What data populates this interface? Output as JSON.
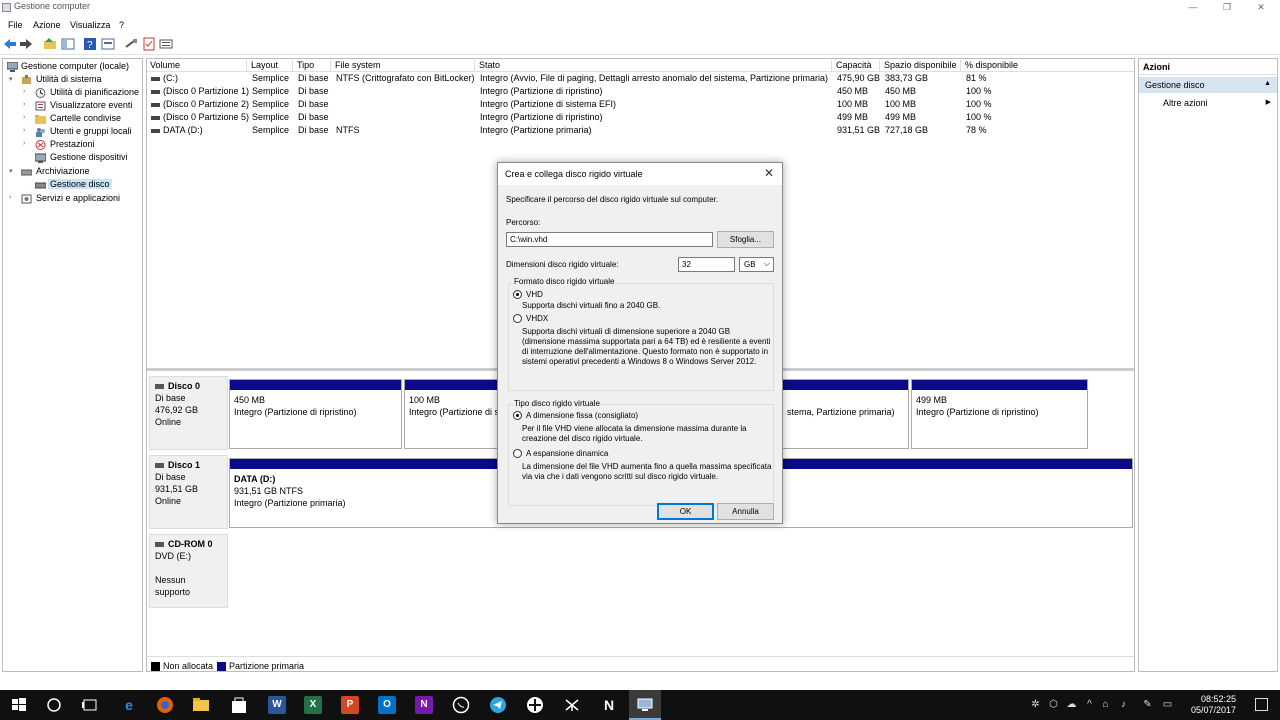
{
  "window": {
    "title": "Gestione computer",
    "controls": [
      "—",
      "❐",
      "✕"
    ]
  },
  "menu": [
    "File",
    "Azione",
    "Visualizza",
    "?"
  ],
  "tree": {
    "root": "Gestione computer (locale)",
    "system_tools": "Utilità di sistema",
    "task_scheduler": "Utilità di pianificazione",
    "event_viewer": "Visualizzatore eventi",
    "shared_folders": "Cartelle condivise",
    "users_groups": "Utenti e gruppi locali",
    "performance": "Prestazioni",
    "device_manager": "Gestione dispositivi",
    "storage": "Archiviazione",
    "disk_management": "Gestione disco",
    "services": "Servizi e applicazioni"
  },
  "volumes": {
    "headers": [
      "Volume",
      "Layout",
      "Tipo",
      "File system",
      "Stato",
      "Capacità",
      "Spazio disponibile",
      "% disponibile"
    ],
    "rows": [
      [
        "(C:)",
        "Semplice",
        "Di base",
        "NTFS (Crittografato con BitLocker)",
        "Integro (Avvio, File di paging, Dettagli arresto anomalo del sistema, Partizione primaria)",
        "475,90 GB",
        "383,73 GB",
        "81 %"
      ],
      [
        "(Disco 0 Partizione 1)",
        "Semplice",
        "Di base",
        "",
        "Integro (Partizione di ripristino)",
        "450 MB",
        "450 MB",
        "100 %"
      ],
      [
        "(Disco 0 Partizione 2)",
        "Semplice",
        "Di base",
        "",
        "Integro (Partizione di sistema EFI)",
        "100 MB",
        "100 MB",
        "100 %"
      ],
      [
        "(Disco 0 Partizione 5)",
        "Semplice",
        "Di base",
        "",
        "Integro (Partizione di ripristino)",
        "499 MB",
        "499 MB",
        "100 %"
      ],
      [
        "DATA (D:)",
        "Semplice",
        "Di base",
        "NTFS",
        "Integro (Partizione primaria)",
        "931,51 GB",
        "727,18 GB",
        "78 %"
      ]
    ]
  },
  "disks": [
    {
      "name": "Disco 0",
      "type": "Di base",
      "size": "476,92 GB",
      "status": "Online"
    },
    {
      "name": "Disco 1",
      "type": "Di base",
      "size": "931,51 GB",
      "status": "Online"
    },
    {
      "name": "CD-ROM 0",
      "type": "DVD (E:)",
      "size": "",
      "status": "Nessun supporto"
    }
  ],
  "partitions": {
    "d0p1": {
      "size": "450 MB",
      "status": "Integro (Partizione di ripristino)"
    },
    "d0p2": {
      "size": "100 MB",
      "status": "Integro (Partizione di s"
    },
    "d0p3": {
      "status": "stema, Partizione primaria)"
    },
    "d0p5": {
      "size": "499 MB",
      "status": "Integro (Partizione di ripristino)"
    },
    "d1p1": {
      "name": "DATA  (D:)",
      "size": "931,51 GB NTFS",
      "status": "Integro (Partizione primaria)"
    }
  },
  "legend": {
    "unallocated": "Non allocata",
    "primary": "Partizione primaria"
  },
  "actions": {
    "header": "Azioni",
    "section": "Gestione disco",
    "more": "Altre azioni"
  },
  "dialog": {
    "title": "Crea e collega disco rigido virtuale",
    "intro": "Specificare il percorso del disco rigido virtuale sul computer.",
    "path_label": "Percorso:",
    "path_value": "C:\\win.vhd",
    "browse": "Sfoglia...",
    "size_label": "Dimensioni disco rigido virtuale:",
    "size_value": "32",
    "size_unit": "GB",
    "format_group": "Formato disco rigido virtuale",
    "vhd": "VHD",
    "vhd_desc": "Supporta dischi virtuali fino a 2040 GB.",
    "vhdx": "VHDX",
    "vhdx_desc": "Supporta dischi virtuali di dimensione superiore a 2040 GB (dimensione massima supportata pari a 64 TB) ed è resiliente a eventi di interruzione dell'alimentazione. Questo formato non è supportato in sistemi operativi precedenti a Windows 8 o Windows Server 2012.",
    "type_group": "Tipo disco rigido virtuale",
    "fixed": "A dimensione fissa (consigliato)",
    "fixed_desc": "Per il file VHD viene allocata la dimensione massima durante la creazione del disco rigido virtuale.",
    "dynamic": "A espansione dinamica",
    "dynamic_desc": "La dimensione del file VHD aumenta fino a quella massima specificata via via che i dati vengono scritti sul disco rigido virtuale.",
    "ok": "OK",
    "cancel": "Annulla"
  },
  "taskbar": {
    "time": "08:52:25",
    "date": "05/07/2017"
  },
  "colors": {
    "primary_partition": "#0a0a8a",
    "unallocated": "#000000",
    "taskbar": "#101010"
  }
}
